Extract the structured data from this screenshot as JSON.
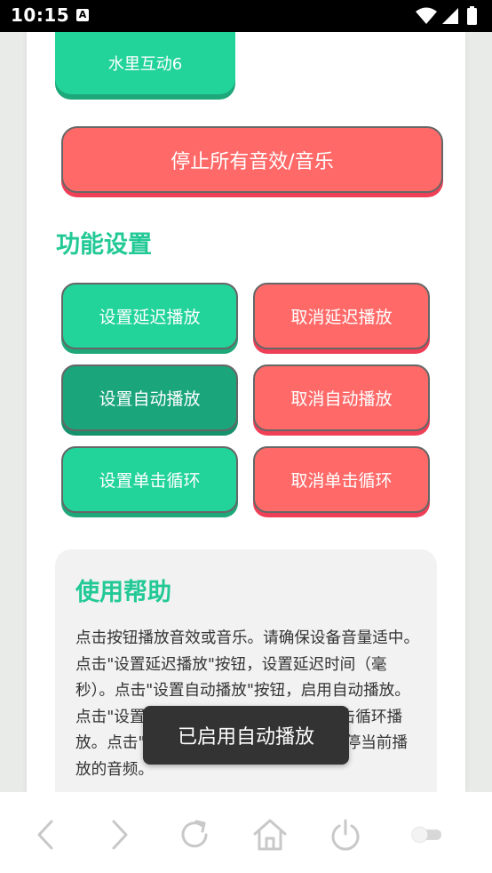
{
  "status_bar": {
    "time": "10:15",
    "notification_icon": "A"
  },
  "page": {
    "top_button": "水里互动6",
    "stop_button": "停止所有音效/音乐",
    "settings_title": "功能设置",
    "buttons": {
      "set_delay": "设置延迟播放",
      "cancel_delay": "取消延迟播放",
      "set_auto": "设置自动播放",
      "cancel_auto": "取消自动播放",
      "set_loop": "设置单击循环",
      "cancel_loop": "取消单击循环"
    },
    "help": {
      "title": "使用帮助",
      "text": "点击按钮播放音效或音乐。请确保设备音量适中。点击\"设置延迟播放\"按钮，设置延迟时间（毫秒）。点击\"设置自动播放\"按钮，启用自动播放。点击\"设置单击循环播放\"按钮，设置单击循环播放。点击\"停止所有音效/音乐\"按钮，暂停当前播放的音频。"
    }
  },
  "toast": "已启用自动播放",
  "colors": {
    "green": "#22d39a",
    "dark_green": "#1aa57a",
    "red": "#ff6a69",
    "title_green": "#22c995"
  }
}
